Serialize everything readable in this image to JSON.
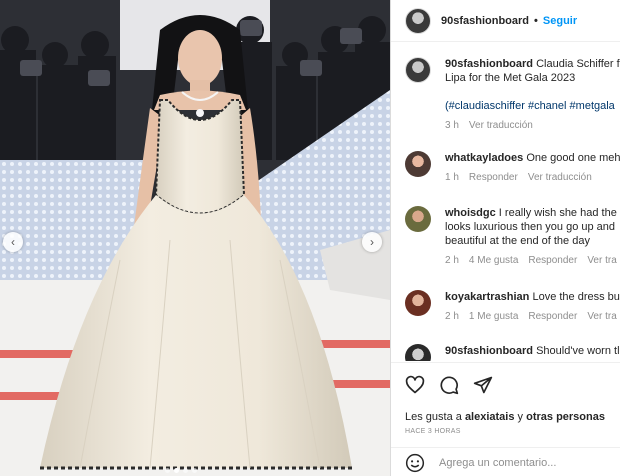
{
  "post": {
    "image_description_icons": {
      "prev": "chevron-left-icon",
      "next": "chevron-right-icon"
    }
  },
  "header": {
    "username": "90sfashionboard",
    "separator": "•",
    "follow_label": "Seguir"
  },
  "caption": {
    "username": "90sfashionboard",
    "text_line1": "Claudia Schiffer fo",
    "text_line2": "Lipa for the Met Gala 2023",
    "hashtags": "(#claudiaschiffer #chanel #metgala",
    "time": "3 h",
    "translate": "Ver traducción"
  },
  "comments": [
    {
      "username": "whatkayladoes",
      "text": "One good one meh",
      "time": "1 h",
      "likes": "",
      "reply": "Responder",
      "translate": "Ver traducción"
    },
    {
      "username": "whoisdgc",
      "text": "I really wish she had the",
      "line2": "looks luxurious then you go up and",
      "line3": "beautiful at the end of the day",
      "time": "2 h",
      "likes": "4 Me gusta",
      "reply": "Responder",
      "translate": "Ver tra"
    },
    {
      "username": "koyakartrashian",
      "text": "Love the dress bu",
      "time": "2 h",
      "likes": "1 Me gusta",
      "reply": "Responder",
      "translate": "Ver tra"
    },
    {
      "username": "90sfashionboard",
      "text": "Should've worn tl"
    }
  ],
  "actions": {
    "likes_prefix": "Les gusta a",
    "likes_user": "alexiatais",
    "likes_middle": "y",
    "likes_suffix": "otras personas",
    "time_ago": "HACE 3 HORAS"
  },
  "comment_box": {
    "placeholder": "Agrega un comentario..."
  },
  "colors": {
    "accent": "#0095f6",
    "hashtag": "#00376b",
    "secondary_text": "#8e8e8e",
    "carpet_stripe": "#e26a63",
    "dress": "#efe8da"
  }
}
